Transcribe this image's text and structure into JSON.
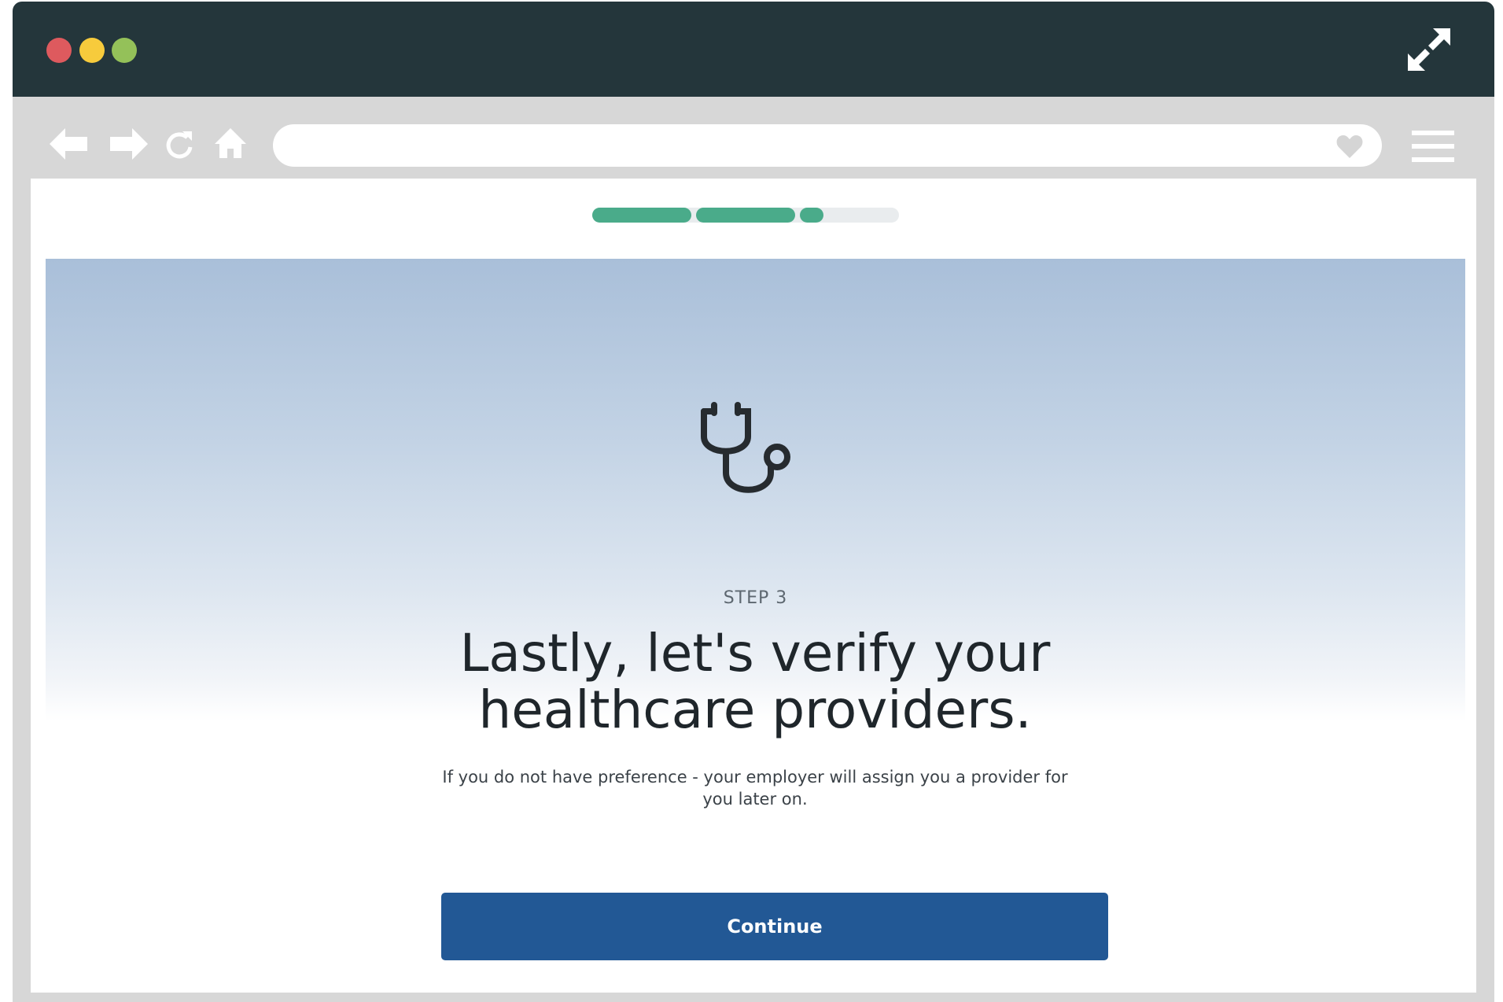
{
  "window": {
    "controls": [
      "close",
      "minimize",
      "maximize"
    ],
    "colors": {
      "titlebar": "#24363b",
      "close": "#de5a5e",
      "minimize": "#f7cb3c",
      "maximize": "#94c159"
    }
  },
  "browser": {
    "nav_icons": [
      "back-arrow-icon",
      "forward-arrow-icon",
      "reload-icon",
      "home-icon"
    ],
    "address_bar": {
      "value": ""
    },
    "bookmark_icon": "heart-icon",
    "menu_icon": "hamburger-menu-icon"
  },
  "progress": {
    "total_steps": 3,
    "completed_steps": 2,
    "current_step_fraction": 0.22,
    "color": "#4aab8a"
  },
  "page": {
    "icon": "stethoscope-icon",
    "step_label": "STEP 3",
    "headline": "Lastly, let's verify your healthcare providers.",
    "subtext": "If you do not have preference - your employer will assign you a provider for you later on.",
    "continue_label": "Continue",
    "accent_color": "#225895"
  }
}
